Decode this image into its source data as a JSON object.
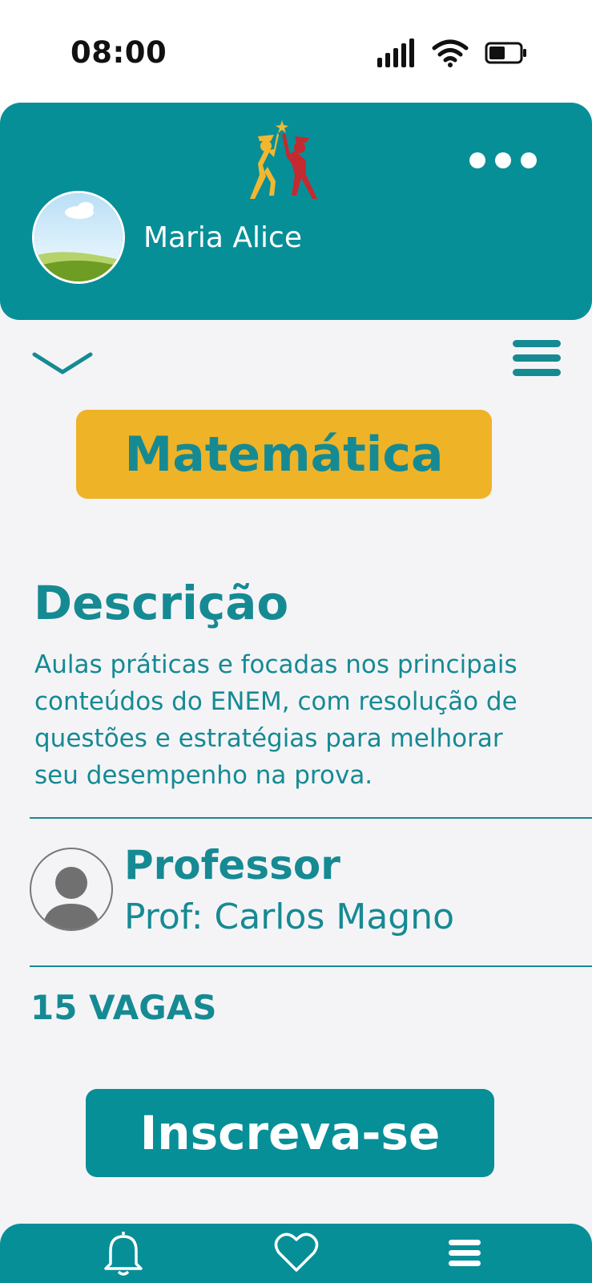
{
  "status_bar": {
    "time": "08:00"
  },
  "header": {
    "user_name": "Maria Alice"
  },
  "course": {
    "subject": "Matemática",
    "description_title": "Descrição",
    "description": "Aulas práticas e focadas nos principais conteúdos do ENEM, com resolução de questões e estratégias para melhorar seu desempenho na prova.",
    "professor_title": "Professor",
    "professor_name": "Prof: Carlos Magno",
    "vacancies": "15 VAGAS",
    "subscribe_label": "Inscreva-se"
  },
  "bottom_nav": [
    "bell-icon",
    "heart-icon",
    "menu-icon"
  ],
  "colors": {
    "primary": "#078f98",
    "accent": "#efb327",
    "text": "#168a93",
    "background": "#f4f4f7"
  }
}
